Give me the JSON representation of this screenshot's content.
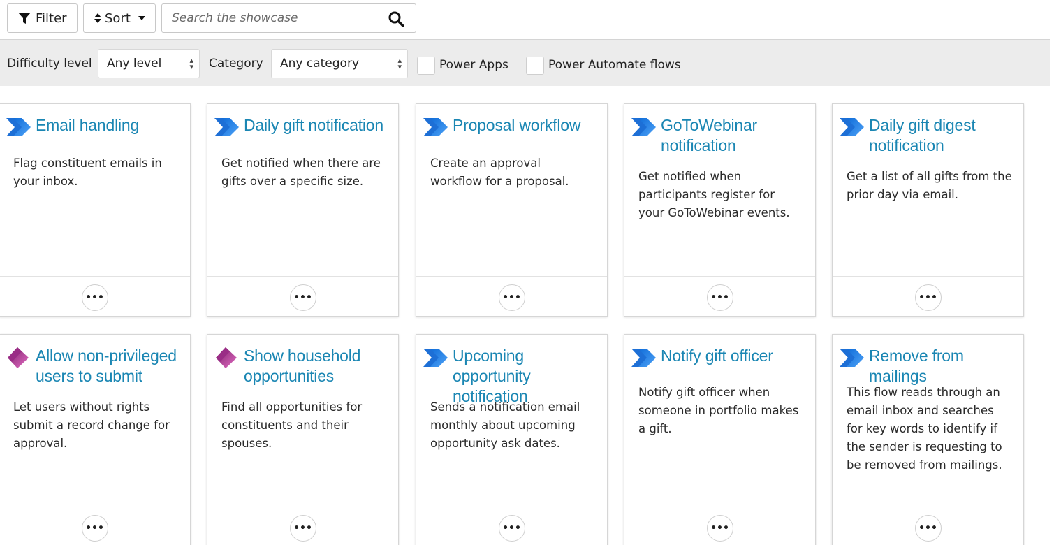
{
  "toolbar": {
    "filter_label": "Filter",
    "sort_label": "Sort",
    "search_placeholder": "Search the showcase"
  },
  "filters": {
    "difficulty_label": "Difficulty level",
    "difficulty_value": "Any level",
    "category_label": "Category",
    "category_value": "Any category",
    "power_apps_label": "Power Apps",
    "power_automate_label": "Power Automate flows"
  },
  "colors": {
    "title_blue": "#1a86b3",
    "flow_icon": "#2b7de9",
    "apps_icon": "#b0368f"
  },
  "cards": [
    {
      "title": "Email handling",
      "desc": "Flag constituent emails in your inbox.",
      "icon": "power-automate-icon",
      "more": "•••"
    },
    {
      "title": "Daily gift notification",
      "desc": "Get notified when there are gifts over a specific size.",
      "icon": "power-automate-icon",
      "more": "•••"
    },
    {
      "title": "Proposal workflow",
      "desc": "Create an approval workflow for a proposal.",
      "icon": "power-automate-icon",
      "more": "•••"
    },
    {
      "title": "GoToWebinar notification",
      "desc": "Get notified when participants register for your GoToWebinar events.",
      "icon": "power-automate-icon",
      "more": "•••"
    },
    {
      "title": "Daily gift digest notification",
      "desc": "Get a list of all gifts from the prior day via email.",
      "icon": "power-automate-icon",
      "more": "•••"
    },
    {
      "title": "Allow non-privileged users to submit",
      "desc": "Let users without rights submit a record change for approval.",
      "icon": "power-apps-icon",
      "more": "•••"
    },
    {
      "title": "Show household opportunities",
      "desc": "Find all opportunities for constituents and their spouses.",
      "icon": "power-apps-icon",
      "more": "•••"
    },
    {
      "title": "Upcoming opportunity notification",
      "desc": "Sends a notification email monthly about upcoming opportunity ask dates.",
      "icon": "power-automate-icon",
      "more": "•••"
    },
    {
      "title": "Notify gift officer",
      "desc": "Notify gift officer when someone in portfolio makes a gift.",
      "icon": "power-automate-icon",
      "more": "•••"
    },
    {
      "title": "Remove from mailings",
      "desc": "This flow reads through an email inbox and searches for key words to identify if the sender is requesting to be removed from mailings.",
      "icon": "power-automate-icon",
      "more": "•••"
    }
  ]
}
